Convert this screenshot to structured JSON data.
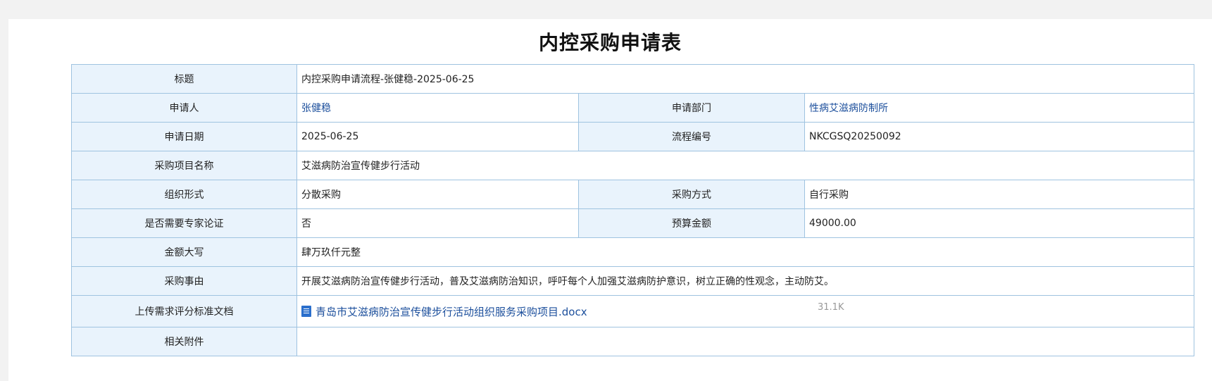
{
  "form_title": "内控采购申请表",
  "rows": {
    "title": {
      "label": "标题",
      "value": "内控采购申请流程-张健稳-2025-06-25"
    },
    "applicant": {
      "label": "申请人",
      "value": "张健稳"
    },
    "department": {
      "label": "申请部门",
      "value": "性病艾滋病防制所"
    },
    "apply_date": {
      "label": "申请日期",
      "value": "2025-06-25"
    },
    "process_no": {
      "label": "流程编号",
      "value": "NKCGSQ20250092"
    },
    "project_name": {
      "label": "采购项目名称",
      "value": "艾滋病防治宣传健步行活动"
    },
    "org_form": {
      "label": "组织形式",
      "value": "分散采购"
    },
    "purchase_method": {
      "label": "采购方式",
      "value": "自行采购"
    },
    "expert_review": {
      "label": "是否需要专家论证",
      "value": "否"
    },
    "budget": {
      "label": "预算金额",
      "value": "49000.00"
    },
    "amount_upper": {
      "label": "金额大写",
      "value": "肆万玖仟元整"
    },
    "reason": {
      "label": "采购事由",
      "value": "开展艾滋病防治宣传健步行活动，普及艾滋病防治知识，呼吁每个人加强艾滋病防护意识，树立正确的性观念，主动防艾。"
    },
    "upload_doc": {
      "label": "上传需求评分标准文档",
      "file_name": "青岛市艾滋病防治宣传健步行活动组织服务采购项目.docx",
      "file_size": "31.1K",
      "file_icon": "docx-file-icon"
    },
    "attachments": {
      "label": "相关附件",
      "value": ""
    }
  },
  "colors": {
    "label_bg": "#e9f3fc",
    "border": "#9fc3e0",
    "link": "#1c4f9c"
  }
}
